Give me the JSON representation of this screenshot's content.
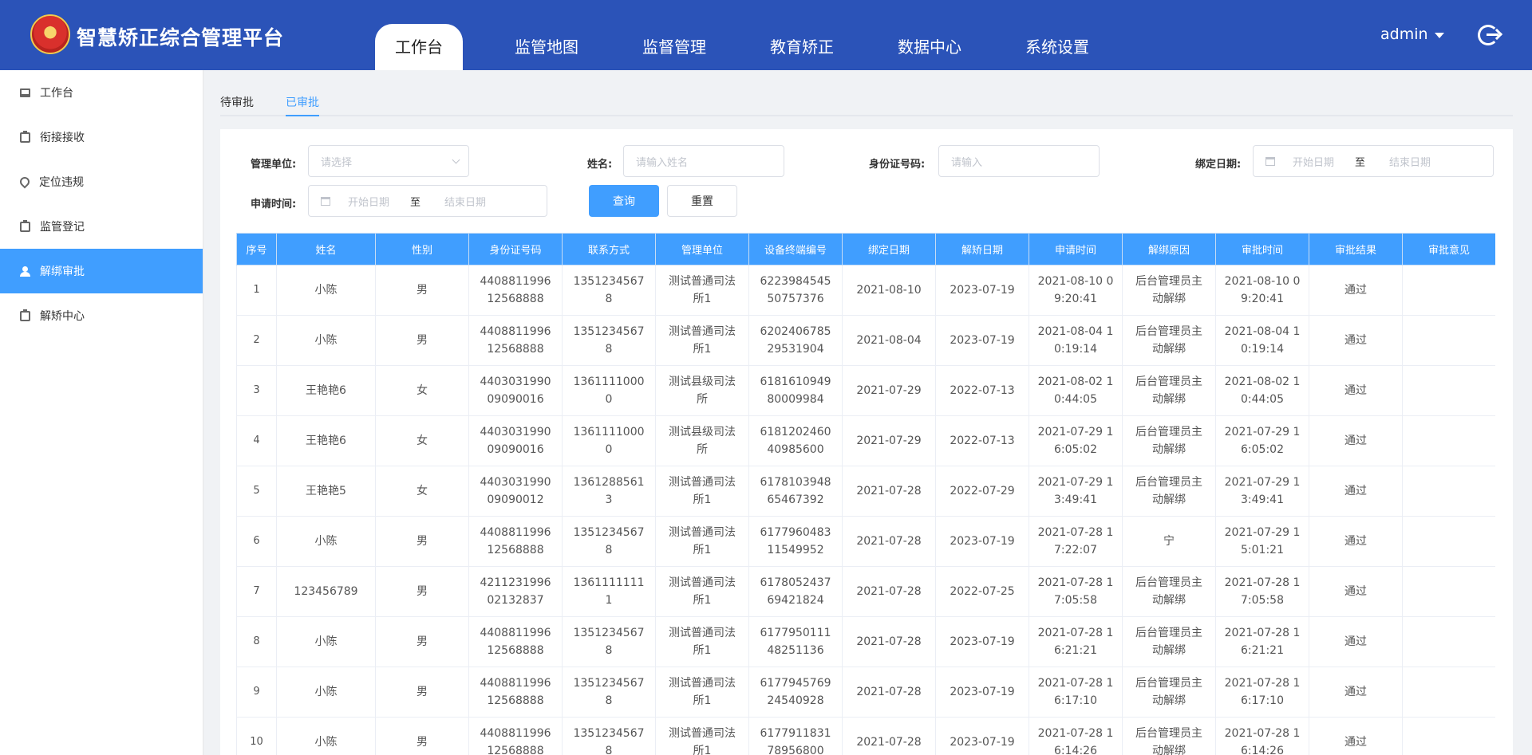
{
  "app": {
    "title": "智慧矫正综合管理平台"
  },
  "nav": {
    "items": [
      "工作台",
      "监管地图",
      "监督管理",
      "教育矫正",
      "数据中心",
      "系统设置"
    ],
    "active_index": 0
  },
  "user": {
    "name": "admin"
  },
  "sidebar": {
    "items": [
      {
        "label": "工作台",
        "icon": "monitor-icon"
      },
      {
        "label": "衔接接收",
        "icon": "clipboard-icon"
      },
      {
        "label": "定位违规",
        "icon": "location-pin-icon"
      },
      {
        "label": "监管登记",
        "icon": "clipboard-icon"
      },
      {
        "label": "解绑审批",
        "icon": "user-icon"
      },
      {
        "label": "解矫中心",
        "icon": "clipboard-icon"
      }
    ],
    "active_index": 4
  },
  "tabs": {
    "items": [
      "待审批",
      "已审批"
    ],
    "active_index": 1
  },
  "filters": {
    "unit_label": "管理单位:",
    "unit_placeholder": "请选择",
    "name_label": "姓名:",
    "name_placeholder": "请输入姓名",
    "id_label": "身份证号码:",
    "id_placeholder": "请输入",
    "bind_label": "绑定日期:",
    "apply_label": "申请时间:",
    "start_placeholder": "开始日期",
    "sep": "至",
    "end_placeholder": "结束日期",
    "query_button": "查询",
    "reset_button": "重置"
  },
  "table": {
    "columns": [
      "序号",
      "姓名",
      "性别",
      "身份证号码",
      "联系方式",
      "管理单位",
      "设备终端编号",
      "绑定日期",
      "解矫日期",
      "申请时间",
      "解绑原因",
      "审批时间",
      "审批结果",
      "审批意见"
    ],
    "rows": [
      [
        "1",
        "小陈",
        "男",
        "440881199612568888",
        "13512345678",
        "测试普通司法所1",
        "622398454550757376",
        "2021-08-10",
        "2023-07-19",
        "2021-08-10 09:20:41",
        "后台管理员主动解绑",
        "2021-08-10 09:20:41",
        "通过",
        ""
      ],
      [
        "2",
        "小陈",
        "男",
        "440881199612568888",
        "13512345678",
        "测试普通司法所1",
        "620240678529531904",
        "2021-08-04",
        "2023-07-19",
        "2021-08-04 10:19:14",
        "后台管理员主动解绑",
        "2021-08-04 10:19:14",
        "通过",
        ""
      ],
      [
        "3",
        "王艳艳6",
        "女",
        "440303199009090016",
        "13611110000",
        "测试县级司法所",
        "618161094980009984",
        "2021-07-29",
        "2022-07-13",
        "2021-08-02 10:44:05",
        "后台管理员主动解绑",
        "2021-08-02 10:44:05",
        "通过",
        ""
      ],
      [
        "4",
        "王艳艳6",
        "女",
        "440303199009090016",
        "13611110000",
        "测试县级司法所",
        "618120246040985600",
        "2021-07-29",
        "2022-07-13",
        "2021-07-29 16:05:02",
        "后台管理员主动解绑",
        "2021-07-29 16:05:02",
        "通过",
        ""
      ],
      [
        "5",
        "王艳艳5",
        "女",
        "440303199009090012",
        "13612885613",
        "测试普通司法所1",
        "617810394865467392",
        "2021-07-28",
        "2022-07-29",
        "2021-07-29 13:49:41",
        "后台管理员主动解绑",
        "2021-07-29 13:49:41",
        "通过",
        ""
      ],
      [
        "6",
        "小陈",
        "男",
        "440881199612568888",
        "13512345678",
        "测试普通司法所1",
        "617796048311549952",
        "2021-07-28",
        "2023-07-19",
        "2021-07-28 17:22:07",
        "宁",
        "2021-07-29 15:01:21",
        "通过",
        ""
      ],
      [
        "7",
        "123456789",
        "男",
        "421123199602132837",
        "13611111111",
        "测试普通司法所1",
        "617805243769421824",
        "2021-07-28",
        "2022-07-25",
        "2021-07-28 17:05:58",
        "后台管理员主动解绑",
        "2021-07-28 17:05:58",
        "通过",
        ""
      ],
      [
        "8",
        "小陈",
        "男",
        "440881199612568888",
        "13512345678",
        "测试普通司法所1",
        "617795011148251136",
        "2021-07-28",
        "2023-07-19",
        "2021-07-28 16:21:21",
        "后台管理员主动解绑",
        "2021-07-28 16:21:21",
        "通过",
        ""
      ],
      [
        "9",
        "小陈",
        "男",
        "440881199612568888",
        "13512345678",
        "测试普通司法所1",
        "617794576924540928",
        "2021-07-28",
        "2023-07-19",
        "2021-07-28 16:17:10",
        "后台管理员主动解绑",
        "2021-07-28 16:17:10",
        "通过",
        ""
      ],
      [
        "10",
        "小陈",
        "男",
        "440881199612568888",
        "13512345678",
        "测试普通司法所1",
        "617791183178956800",
        "2021-07-28",
        "2023-07-19",
        "2021-07-28 16:14:26",
        "后台管理员主动解绑",
        "2021-07-28 16:14:26",
        "通过",
        ""
      ]
    ]
  }
}
